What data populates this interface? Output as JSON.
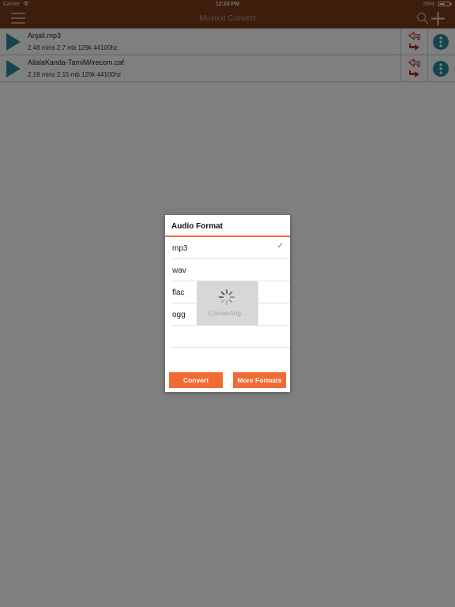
{
  "status_bar": {
    "carrier": "Carrier",
    "time": "12:20 PM",
    "battery": "59%",
    "battery_level": 0.59
  },
  "nav": {
    "title": "Musixxi Convert",
    "icons": [
      "menu-icon",
      "search-icon",
      "plus-icon"
    ]
  },
  "files": [
    {
      "name": "Anjali.mp3",
      "meta": "2.48 mins 2.7 mb 129k 44100hz"
    },
    {
      "name": "AllalaKanda-TamilWirecom.caf",
      "meta": "2.19 mins 2.15 mb 129k 44100hz"
    }
  ],
  "dialog": {
    "title": "Audio Format",
    "options": [
      "mp3",
      "wav",
      "flac",
      "ogg"
    ],
    "selected": "mp3",
    "convert_label": "Convert",
    "more_formats_label": "More Formats"
  },
  "hud": {
    "text": "Converting..."
  },
  "colors": {
    "bar": "#7a3a17",
    "accent": "#f26a33",
    "play": "#2a8a9a",
    "more": "#2a8a9a",
    "convert_icon": "#b83a2e"
  }
}
